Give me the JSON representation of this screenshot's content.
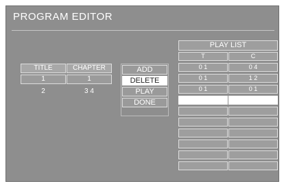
{
  "screen_title": "PROGRAM EDITOR",
  "chapter_table": {
    "headers": [
      "TITLE",
      "CHAPTER"
    ],
    "selected_row": [
      "1",
      "1"
    ],
    "info_row": [
      "2",
      "3 4"
    ]
  },
  "buttons": [
    "ADD",
    "DELETE",
    "PLAY",
    "DONE"
  ],
  "selected_button": "DELETE",
  "playlist": {
    "title": "PLAY LIST",
    "columns": [
      "T",
      "C"
    ],
    "rows": [
      [
        "0 1",
        "0 4"
      ],
      [
        "0 1",
        "1 2"
      ],
      [
        "0 1",
        "0 1"
      ]
    ],
    "empty_rows": 7
  }
}
